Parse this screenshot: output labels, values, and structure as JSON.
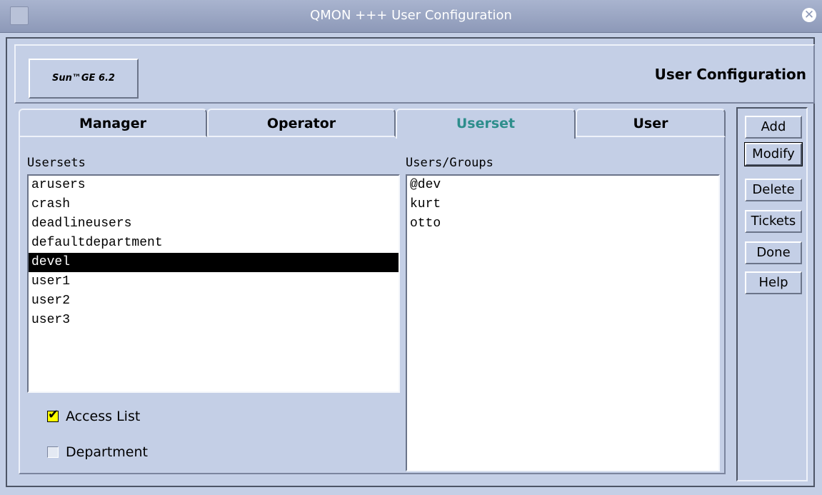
{
  "window": {
    "title": "QMON +++ User Configuration",
    "close_icon": "close-icon"
  },
  "header": {
    "logo": "Sun™GE 6.2",
    "title": "User Configuration"
  },
  "tabs": [
    {
      "label": "Manager",
      "active": false
    },
    {
      "label": "Operator",
      "active": false
    },
    {
      "label": "Userset",
      "active": true
    },
    {
      "label": "User",
      "active": false
    }
  ],
  "usersets": {
    "label": "Usersets",
    "items": [
      "arusers",
      "crash",
      "deadlineusers",
      "defaultdepartment",
      "devel",
      "user1",
      "user2",
      "user3"
    ],
    "selected": "devel"
  },
  "users_groups": {
    "label": "Users/Groups",
    "items": [
      "@dev",
      "kurt",
      "otto"
    ]
  },
  "options": {
    "access_list": {
      "label": "Access List",
      "checked": true
    },
    "department": {
      "label": "Department",
      "checked": false
    }
  },
  "buttons": {
    "add": "Add",
    "modify": "Modify",
    "delete": "Delete",
    "tickets": "Tickets",
    "done": "Done",
    "help": "Help"
  },
  "colors": {
    "background": "#c4cfe6",
    "active_tab_text": "#2e8e8c",
    "selection": "#000000",
    "checkbox_checked": "#ffff00"
  }
}
